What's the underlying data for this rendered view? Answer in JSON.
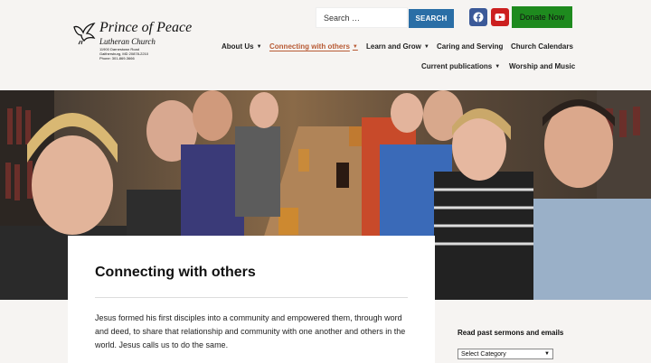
{
  "logo": {
    "title": "Prince of Peace",
    "subtitle": "Lutheran Church",
    "address1": "11900 Darnestown Road",
    "address2": "Gaithersburg, MD 20878-2210",
    "phone": "Phone: 301-869-3666"
  },
  "search": {
    "placeholder": "Search …",
    "button_label": "SEARCH"
  },
  "social": {
    "facebook_icon": "facebook-icon",
    "youtube_icon": "youtube-icon"
  },
  "donate_label": "Donate Now",
  "nav": {
    "about": "About Us",
    "connecting": "Connecting with others",
    "learn": "Learn and Grow",
    "caring": "Caring and Serving",
    "calendars": "Church Calendars",
    "publications": "Current publications",
    "worship": "Worship and Music"
  },
  "page": {
    "title": "Connecting with others",
    "body": "Jesus formed his first disciples into a community and empowered them, through word and deed, to share that relationship and community with one another and others in the world. Jesus calls us to do the same."
  },
  "sidebar": {
    "title": "Read past sermons and emails",
    "select_value": "Select Category"
  },
  "colors": {
    "accent": "#2a6ea6",
    "active_nav": "#b85b35",
    "donate": "#1e8a1e",
    "facebook": "#3b5998",
    "youtube": "#cc1f1f"
  }
}
